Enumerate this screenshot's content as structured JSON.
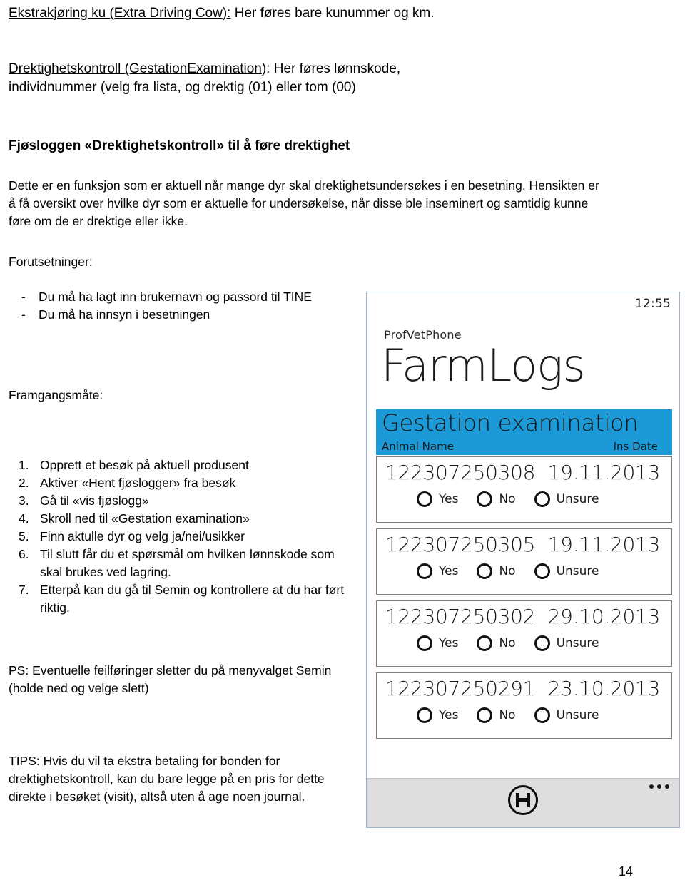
{
  "document": {
    "intro_1": {
      "underlined": "Ekstrakjøring ku (Extra Driving Cow):",
      "rest": " Her føres bare kunummer og km."
    },
    "intro_2": {
      "underlined": "Drektighetskontroll (GestationExamination",
      "rest": "): Her føres lønnskode,",
      "line2": "individnummer (velg fra lista, og drektig (01) eller tom (00)"
    },
    "section_heading": "Fjøsloggen «Drektighetskontroll» til å føre drektighet",
    "body_paragraph": "Dette er en funksjon som er aktuell når mange dyr skal drektighetsundersøkes i en besetning. Hensikten er å få oversikt over hvilke dyr som er aktuelle for undersøkelse, når disse ble inseminert og samtidig kunne føre om de er drektige eller ikke.",
    "prereq_label": "Forutsetninger:",
    "prereq_items": [
      "Du må ha lagt inn brukernavn og passord til TINE",
      "Du må ha innsyn i besetningen"
    ],
    "dash_marker": "-",
    "procedure_label": "Framgangsmåte:",
    "procedure_items": [
      {
        "num": "1.",
        "text": "Opprett et besøk på aktuell produsent"
      },
      {
        "num": "2.",
        "text": "Aktiver «Hent fjøslogger» fra besøk"
      },
      {
        "num": "3.",
        "text": "Gå til «vis fjøslogg»"
      },
      {
        "num": "4.",
        "text": "Skroll ned til «Gestation examination»"
      },
      {
        "num": "5.",
        "text": "Finn aktulle dyr og velg ja/nei/usikker"
      },
      {
        "num": "6.",
        "text": "Til slutt får du et spørsmål om hvilken lønnskode som skal brukes ved lagring."
      },
      {
        "num": "7.",
        "text": "Etterpå kan du gå til Semin og kontrollere at du har ført riktig."
      }
    ],
    "ps_note": "PS: Eventuelle feilføringer sletter du på menyvalget Semin (holde ned og velge slett)",
    "tips_note": "TIPS: Hvis du vil ta ekstra betaling for bonden for drektighetskontroll, kan du bare legge på en pris for dette direkte i besøket (visit), altså uten å age noen journal.",
    "page_number": "14"
  },
  "phone": {
    "status_time": "12:55",
    "app_name": "ProfVetPhone",
    "app_title": "FarmLogs",
    "band": {
      "title": "Gestation examination",
      "col_left": "Animal Name",
      "col_right": "Ins Date",
      "color": "#1c9ad8"
    },
    "options": [
      "Yes",
      "No",
      "Unsure"
    ],
    "rows": [
      {
        "animal": "122307250308",
        "date": "19.11.2013"
      },
      {
        "animal": "122307250305",
        "date": "19.11.2013"
      },
      {
        "animal": "122307250302",
        "date": "29.10.2013"
      },
      {
        "animal": "122307250291",
        "date": "23.10.2013"
      }
    ],
    "appbar": {
      "save_icon": "floppy-disk-icon",
      "more_icon": "ellipsis-icon"
    }
  }
}
